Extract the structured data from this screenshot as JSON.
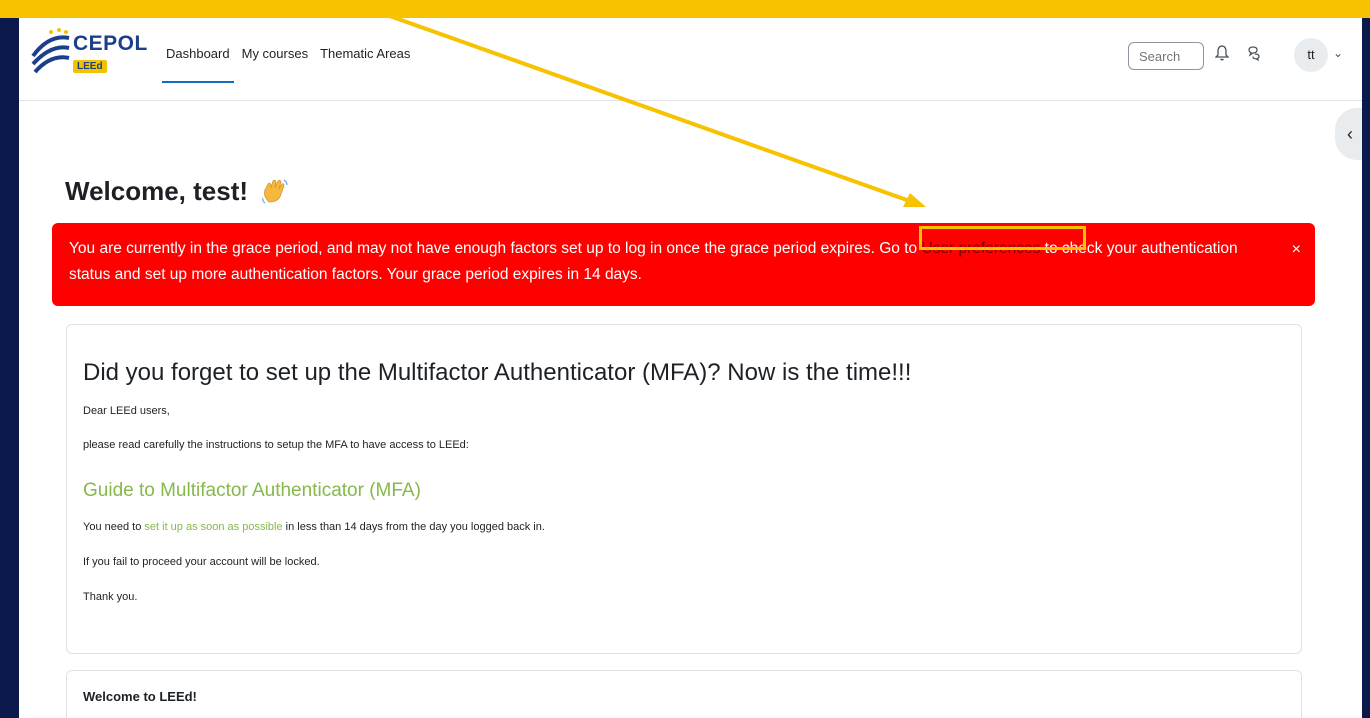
{
  "nav": {
    "logo_text": "CEPOL",
    "logo_sub": "LEEd",
    "links": [
      "Dashboard",
      "My courses",
      "Thematic Areas"
    ],
    "search_placeholder": "Search",
    "avatar_initials": "tt"
  },
  "welcome": {
    "title": "Welcome, test!"
  },
  "alert": {
    "text_before": "You are currently in the grace period, and may not have enough factors set up to log in once the grace period expires. Go to ",
    "link": "User preferences",
    "text_after": " to check your authentication status and set up more authentication factors. Your grace period expires in 14 days.",
    "close": "×"
  },
  "card": {
    "heading": "Did you forget to set up the Multifactor Authenticator (MFA)? Now is the time!!!",
    "greeting": "Dear LEEd users,",
    "instructions": "please read carefully the instructions to setup the MFA to have access to LEEd:",
    "guide_link": "Guide to Multifactor Authenticator (MFA)",
    "need_before": "You need to ",
    "need_link": "set it up as soon as possible",
    "need_after": " in less than 14 days from the day you logged back in.",
    "warning": "If you fail to proceed your account will be locked.",
    "thanks": "Thank you."
  },
  "card2": {
    "heading": "Welcome to LEEd!"
  },
  "colors": {
    "alert_bg": "#ff0000",
    "annotation": "#f7c200",
    "frame_bg": "#0b1a4a",
    "green_link": "#86b84b"
  }
}
